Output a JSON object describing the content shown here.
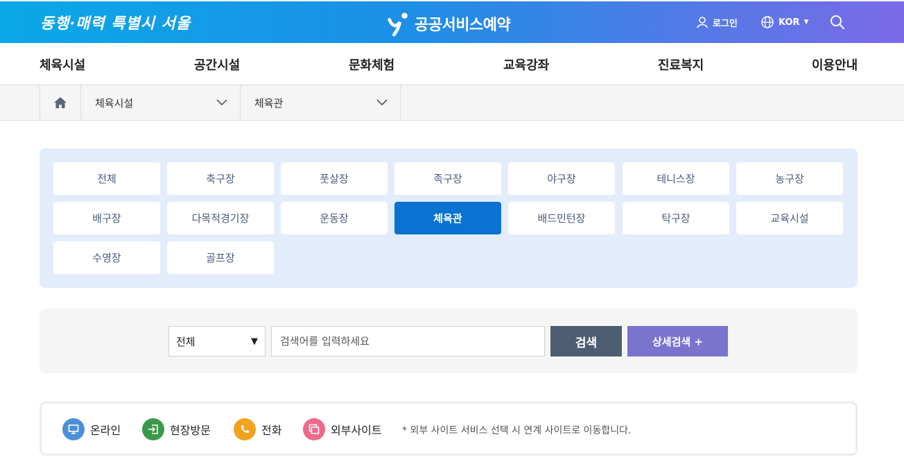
{
  "header": {
    "slogan": "동행·매력 특별시 서울",
    "service_title": "공공서비스예약",
    "login_label": "로그인",
    "language_label": "KOR",
    "colors": {
      "gradient_start": "#0aa8e8",
      "gradient_end": "#7b6ae8"
    }
  },
  "gnb": {
    "items": [
      "체육시설",
      "공간시설",
      "문화체험",
      "교육강좌",
      "진료복지",
      "이용안내"
    ]
  },
  "breadcrumb": {
    "home_icon": "home-icon",
    "level1": "체육시설",
    "level2": "체육관"
  },
  "categories": {
    "items": [
      "전체",
      "축구장",
      "풋살장",
      "족구장",
      "야구장",
      "테니스장",
      "농구장",
      "배구장",
      "다목적경기장",
      "운동장",
      "체육관",
      "배드민턴장",
      "탁구장",
      "교육시설",
      "수영장",
      "골프장"
    ],
    "selected": "체육관",
    "active_color": "#0a72d1"
  },
  "search": {
    "filter_value": "전체",
    "placeholder": "검색어를 입력하세요",
    "search_button": "검색",
    "detail_button": "상세검색 +"
  },
  "legend": {
    "online": "온라인",
    "visit": "현장방문",
    "phone": "전화",
    "external": "외부사이트",
    "note": "* 외부 사이트 서비스 선택 시 연계 사이트로 이동합니다.",
    "colors": {
      "online": "#4a90d9",
      "visit": "#3a9a4a",
      "phone": "#f2a21e",
      "external": "#ef6a8a"
    }
  }
}
